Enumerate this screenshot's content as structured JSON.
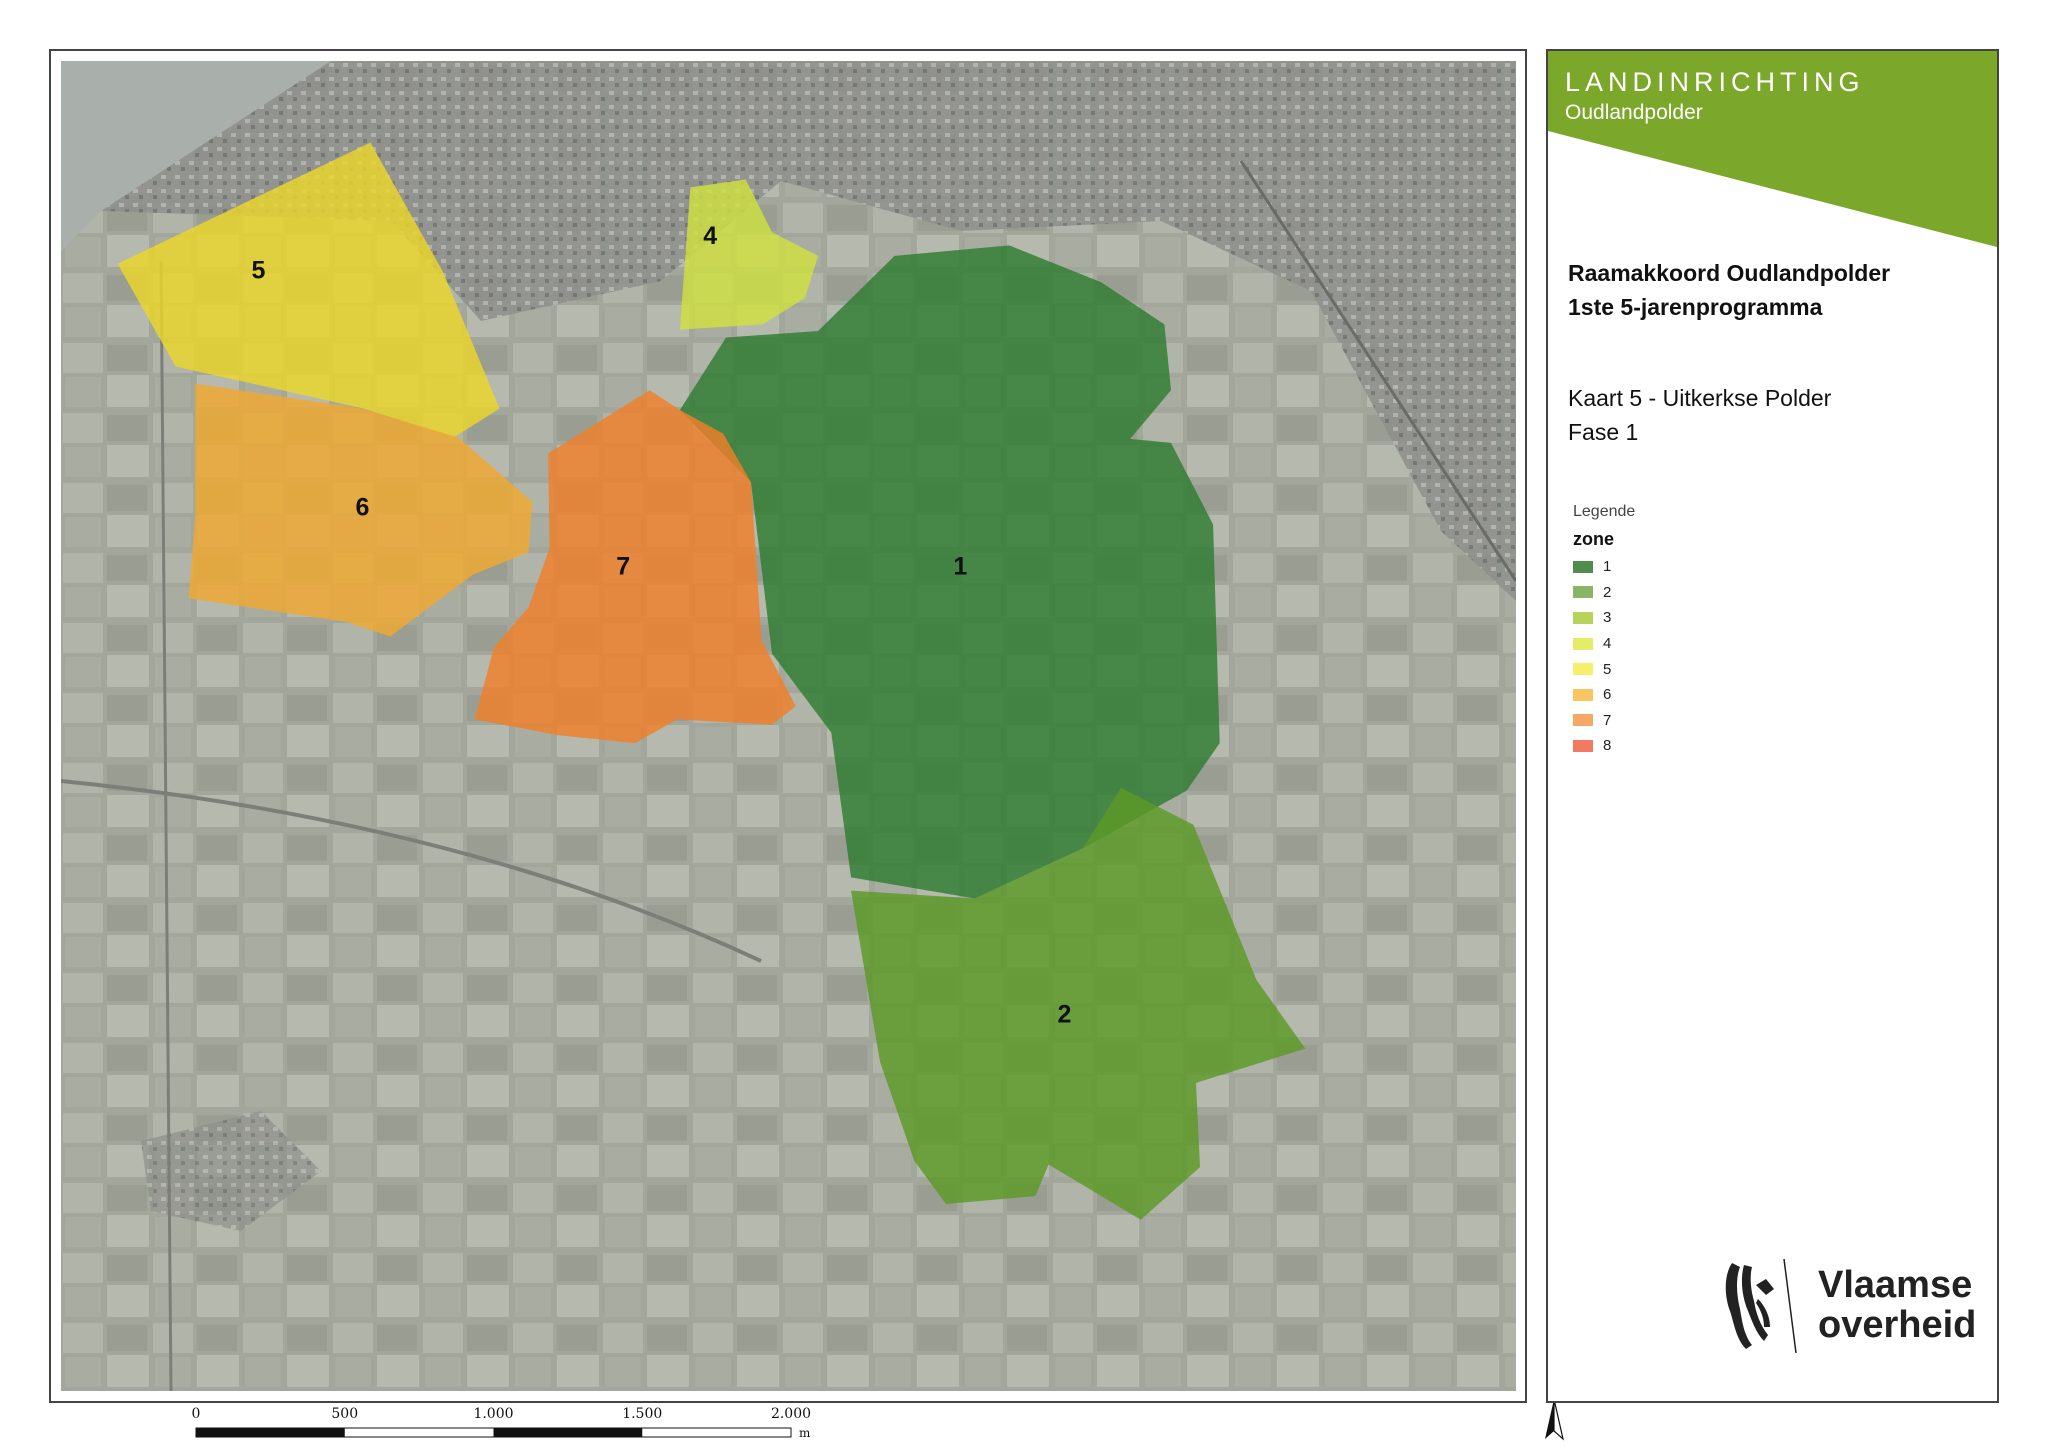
{
  "map": {
    "zones": [
      {
        "id": "1",
        "label": "1",
        "color": "#2e7d32"
      },
      {
        "id": "2",
        "label": "2",
        "color": "#5b9a26"
      },
      {
        "id": "4",
        "label": "4",
        "color": "#cfe040"
      },
      {
        "id": "5",
        "label": "5",
        "color": "#ecd72a"
      },
      {
        "id": "6",
        "label": "6",
        "color": "#f0a830"
      },
      {
        "id": "7",
        "label": "7",
        "color": "#f07f2a"
      }
    ],
    "scalebar": {
      "ticks": [
        "0",
        "500",
        "1.000",
        "1.500",
        "2.000"
      ],
      "unit": "m"
    },
    "north_label": "N"
  },
  "panel": {
    "program_name": "LANDINRICHTING",
    "program_sub": "Oudlandpolder",
    "title_lines": [
      "Raamakkoord Oudlandpolder",
      "1ste 5-jarenprogramma"
    ],
    "subtitle_lines": [
      "Kaart 5 - Uitkerkse Polder",
      "Fase 1"
    ],
    "legend_title": "Legende",
    "legend_field": "zone",
    "legend_items": [
      {
        "label": "1",
        "color": "#4e8e4a"
      },
      {
        "label": "2",
        "color": "#8ab565"
      },
      {
        "label": "3",
        "color": "#b7d35c"
      },
      {
        "label": "4",
        "color": "#e4ec6a"
      },
      {
        "label": "5",
        "color": "#f7ee6a"
      },
      {
        "label": "6",
        "color": "#f8c660"
      },
      {
        "label": "7",
        "color": "#f6a868"
      },
      {
        "label": "8",
        "color": "#f27a62"
      }
    ],
    "header_color": "#7ba82a",
    "org_line1": "Vlaamse",
    "org_line2": "overheid"
  }
}
